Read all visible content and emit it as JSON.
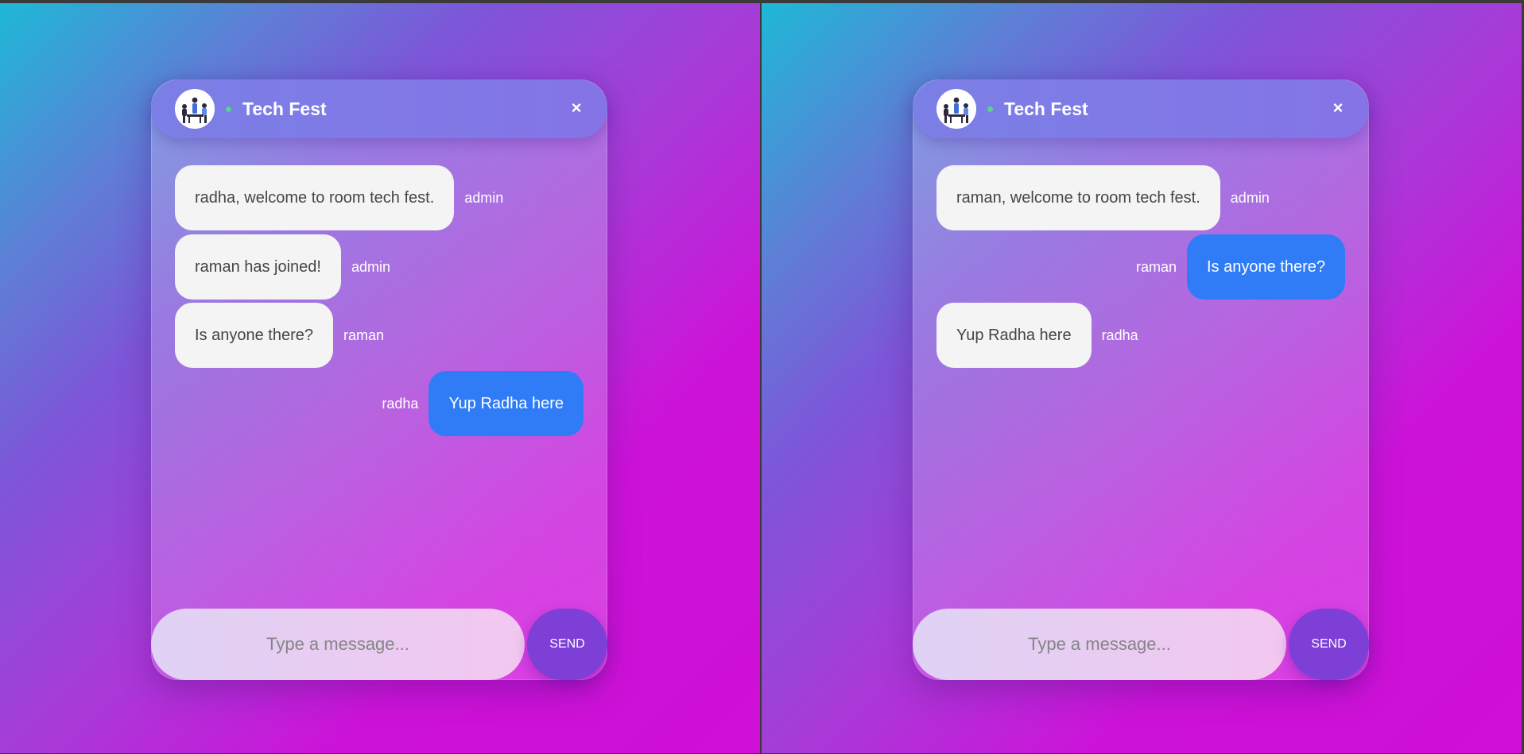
{
  "windows": [
    {
      "room_title": "Tech Fest",
      "messages": [
        {
          "text": "radha, welcome to room tech fest.",
          "sender": "admin",
          "own": false
        },
        {
          "text": "raman has joined!",
          "sender": "admin",
          "own": false
        },
        {
          "text": "Is anyone there?",
          "sender": "raman",
          "own": false
        },
        {
          "text": "Yup Radha here",
          "sender": "radha",
          "own": true
        }
      ],
      "input_placeholder": "Type a message...",
      "send_label": "SEND",
      "close_label": "×"
    },
    {
      "room_title": "Tech Fest",
      "messages": [
        {
          "text": "raman, welcome to room tech fest.",
          "sender": "admin",
          "own": false
        },
        {
          "text": "Is anyone there?",
          "sender": "raman",
          "own": true
        },
        {
          "text": "Yup Radha here",
          "sender": "radha",
          "own": false
        }
      ],
      "input_placeholder": "Type a message...",
      "send_label": "SEND",
      "close_label": "×"
    }
  ],
  "colors": {
    "own_bubble": "#2f7cf6",
    "other_bubble": "#f4f4f4",
    "send_button": "#7d3fd6",
    "online_dot": "#59d489",
    "header": "#7b7fe6"
  },
  "icons": {
    "avatar": "group-meeting-illustration-icon",
    "status": "online-dot-icon",
    "close": "close-icon"
  }
}
